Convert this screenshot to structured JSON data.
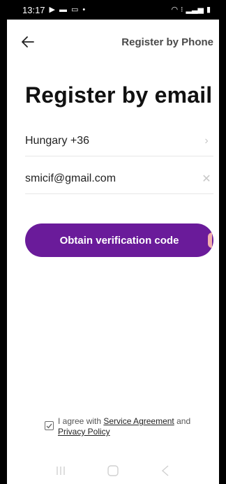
{
  "status_bar": {
    "time": "13:17",
    "icons_left": [
      "play-store-icon",
      "video-icon",
      "gallery-icon",
      "dot-icon"
    ],
    "icons_right": [
      "wifi-icon",
      "volte-icon",
      "signal-icon",
      "battery-icon"
    ]
  },
  "header": {
    "back_icon": "arrow-left-icon",
    "right_link": "Register by Phone"
  },
  "main": {
    "title": "Register by email",
    "country_value": "Hungary +36",
    "email_value": "smicif@gmail.com",
    "submit_label": "Obtain verification code"
  },
  "agreement": {
    "prefix": "I agree with ",
    "service_link": "Service Agreement",
    "middle": " and",
    "privacy_link": "Privacy Policy"
  },
  "colors": {
    "primary": "#6a1b9a",
    "text": "#1c1c1c"
  }
}
